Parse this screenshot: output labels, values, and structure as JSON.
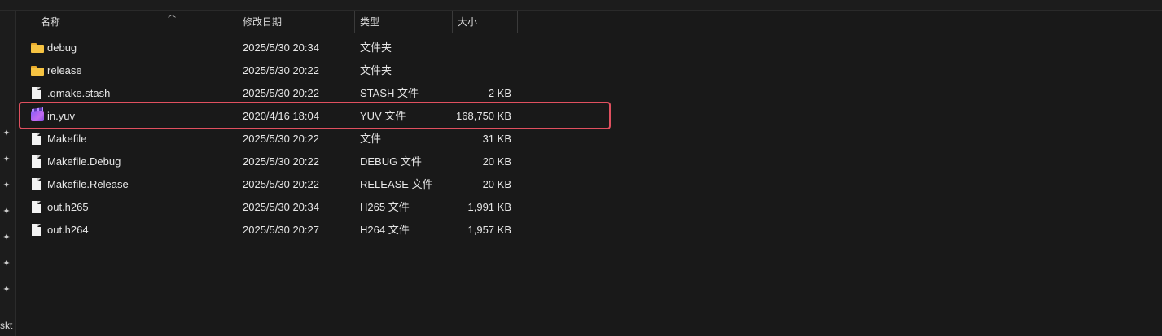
{
  "columns": {
    "name": "名称",
    "date": "修改日期",
    "type": "类型",
    "size": "大小"
  },
  "nav": {
    "label": "skt"
  },
  "files": [
    {
      "name": "debug",
      "date": "2025/5/30 20:34",
      "type": "文件夹",
      "size": "",
      "icon": "folder"
    },
    {
      "name": "release",
      "date": "2025/5/30 20:22",
      "type": "文件夹",
      "size": "",
      "icon": "folder"
    },
    {
      "name": ".qmake.stash",
      "date": "2025/5/30 20:22",
      "type": "STASH 文件",
      "size": "2 KB",
      "icon": "file"
    },
    {
      "name": "in.yuv",
      "date": "2020/4/16 18:04",
      "type": "YUV 文件",
      "size": "168,750 KB",
      "icon": "media-clapper"
    },
    {
      "name": "Makefile",
      "date": "2025/5/30 20:22",
      "type": "文件",
      "size": "31 KB",
      "icon": "file"
    },
    {
      "name": "Makefile.Debug",
      "date": "2025/5/30 20:22",
      "type": "DEBUG 文件",
      "size": "20 KB",
      "icon": "file"
    },
    {
      "name": "Makefile.Release",
      "date": "2025/5/30 20:22",
      "type": "RELEASE 文件",
      "size": "20 KB",
      "icon": "file"
    },
    {
      "name": "out.h265",
      "date": "2025/5/30 20:34",
      "type": "H265 文件",
      "size": "1,991 KB",
      "icon": "file"
    },
    {
      "name": "out.h264",
      "date": "2025/5/30 20:27",
      "type": "H264 文件",
      "size": "1,957 KB",
      "icon": "file"
    }
  ],
  "colors": {
    "background": "#191919",
    "highlight_border": "#e0505f"
  }
}
